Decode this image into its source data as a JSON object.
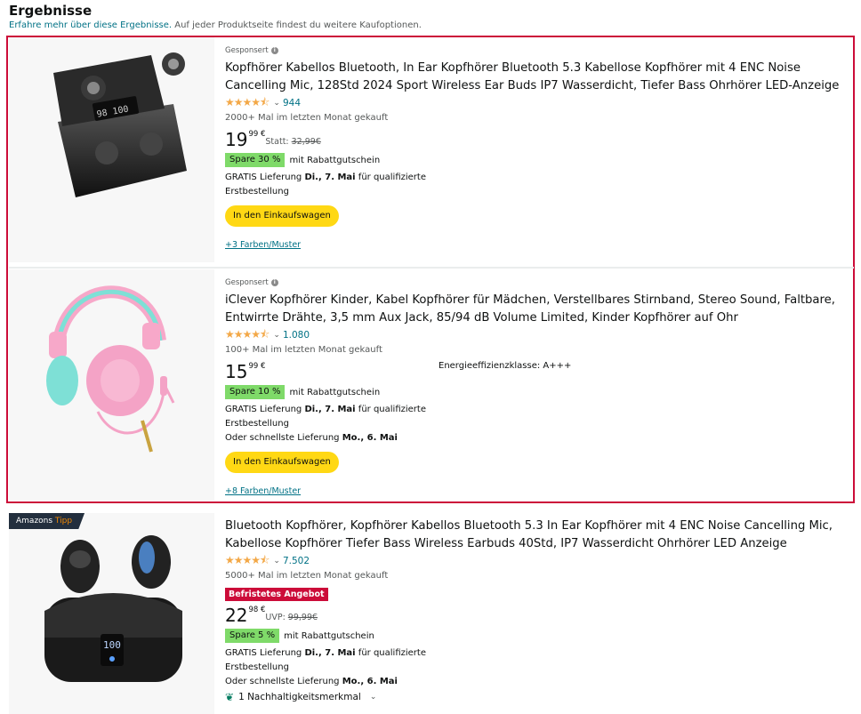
{
  "header": {
    "title": "Ergebnisse",
    "subtitle_link": "Erfahre mehr über diese Ergebnisse.",
    "subtitle_rest": " Auf jeder Produktseite findest du weitere Kaufoptionen."
  },
  "products": [
    {
      "sponsored": "Gesponsert",
      "title": "Kopfhörer Kabellos Bluetooth, In Ear Kopfhörer Bluetooth 5.3 Kabellose Kopfhörer mit 4 ENC Noise Cancelling Mic, 128Std 2024 Sport Wireless Ear Buds IP7 Wasserdicht, Tiefer Bass Ohrhörer LED-Anzeige",
      "rating_value": 4.5,
      "rating_count": "944",
      "bought": "2000+ Mal im letzten Monat gekauft",
      "price_whole": "19",
      "price_frac": "99 €",
      "statt_label": "Statt: ",
      "statt_price": "32,99€",
      "coupon_badge": "Spare 30 %",
      "coupon_text": "mit Rabattgutschein",
      "delivery_prefix": "GRATIS Lieferung ",
      "delivery_date": "Di., 7. Mai",
      "delivery_suffix": " für qualifizierte",
      "delivery_line2": "Erstbestellung",
      "cart_label": "In den Einkaufswagen",
      "variants": "+3 Farben/Muster"
    },
    {
      "sponsored": "Gesponsert",
      "title": "iClever Kopfhörer Kinder, Kabel Kopfhörer für Mädchen, Verstellbares Stirnband, Stereo Sound, Faltbare, Entwirrte Drähte, 3,5 mm Aux Jack, 85/94 dB Volume Limited, Kinder Kopfhörer auf Ohr",
      "rating_value": 4.5,
      "rating_count": "1.080",
      "bought": "100+ Mal im letzten Monat gekauft",
      "price_whole": "15",
      "price_frac": "99 €",
      "energy": "Energieeffizienzklasse: A+++",
      "coupon_badge": "Spare 10 %",
      "coupon_text": "mit Rabattgutschein",
      "delivery_prefix": "GRATIS Lieferung ",
      "delivery_date": "Di., 7. Mai",
      "delivery_suffix": " für qualifizierte",
      "delivery_line2": "Erstbestellung",
      "fast_prefix": "Oder schnellste Lieferung ",
      "fast_date": "Mo., 6. Mai",
      "cart_label": "In den Einkaufswagen",
      "variants": "+8 Farben/Muster"
    },
    {
      "badge_main": "Amazons",
      "badge_accent": " Tipp",
      "title": "Bluetooth Kopfhörer, Kopfhörer Kabellos Bluetooth 5.3 In Ear Kopfhörer mit 4 ENC Noise Cancelling Mic, Kabellose Kopfhörer Tiefer Bass Wireless Earbuds 40Std, IP7 Wasserdicht Ohrhörer LED Anzeige",
      "rating_value": 4.5,
      "rating_count": "7.502",
      "bought": "5000+ Mal im letzten Monat gekauft",
      "deal_badge": "Befristetes Angebot",
      "price_whole": "22",
      "price_frac": "98 €",
      "statt_label": "UVP: ",
      "statt_price": "99,99€",
      "coupon_badge": "Spare 5 %",
      "coupon_text": "mit Rabattgutschein",
      "delivery_prefix": "GRATIS Lieferung ",
      "delivery_date": "Di., 7. Mai",
      "delivery_suffix": " für qualifizierte",
      "delivery_line2": "Erstbestellung",
      "fast_prefix": "Oder schnellste Lieferung ",
      "fast_date": "Mo., 6. Mai",
      "eco_label": "1 Nachhaltigkeitsmerkmal"
    }
  ],
  "icons": {
    "stars": "★★★★⯪",
    "chevron": "⌄",
    "info": "i",
    "leaf": "❦"
  },
  "colors": {
    "sponsored_border": "#cc0c39",
    "link": "#007185",
    "cart_button": "#ffd814",
    "coupon": "#7fda69",
    "deal": "#cc0c39",
    "stars": "#f3a847"
  }
}
